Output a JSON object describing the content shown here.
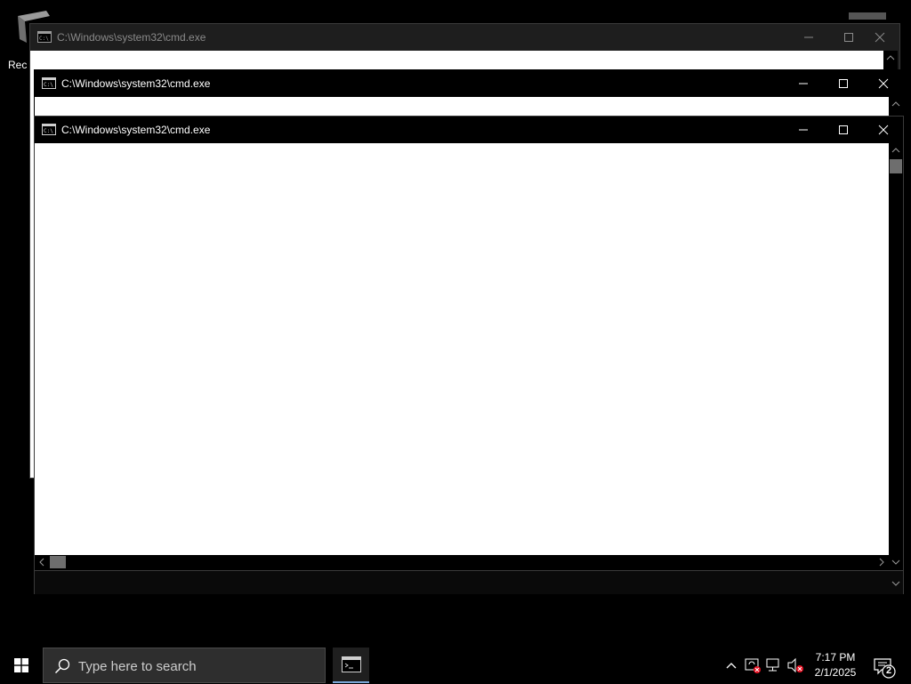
{
  "desktop": {
    "recycle_bin_label": "Rec"
  },
  "windows": [
    {
      "title": "C:\\Windows\\system32\\cmd.exe",
      "state": "inactive"
    },
    {
      "title": "C:\\Windows\\system32\\cmd.exe",
      "state": "inactive"
    },
    {
      "title": "C:\\Windows\\system32\\cmd.exe",
      "state": "active"
    }
  ],
  "taskbar": {
    "search_placeholder": "Type here to search",
    "time": "7:17 PM",
    "date": "2/1/2025",
    "notification_count": "2"
  },
  "colors": {
    "background": "#000000",
    "console_content": "#ffffff",
    "taskbar_accent": "#7aa7d8",
    "tray_error": "#e81123"
  },
  "icons": {
    "start": "windows-logo-icon",
    "search": "search-icon",
    "taskbar_app": "cmd-icon",
    "tray": [
      "chevron-up-icon",
      "sync-error-icon",
      "network-disconnected-icon",
      "volume-muted-icon"
    ],
    "notifications": "action-center-icon"
  }
}
